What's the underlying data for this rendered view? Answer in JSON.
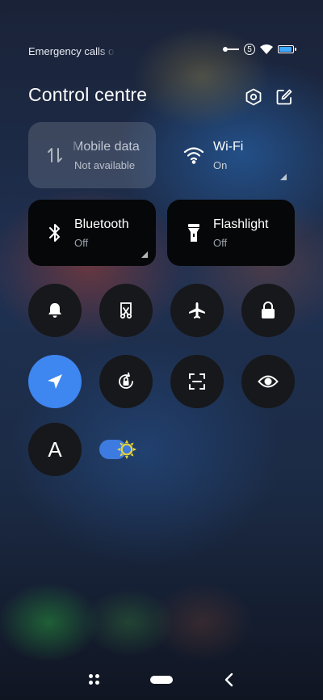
{
  "status_bar": {
    "text": "Emergency calls o",
    "sim_number": "5",
    "battery_level": 0.95
  },
  "header": {
    "title": "Control centre",
    "settings_icon": "hexagon-settings-icon",
    "edit_icon": "edit-icon"
  },
  "tiles": {
    "mobile_data": {
      "label": "Mobile data",
      "status": "Not available",
      "icon": "mobile-data-icon"
    },
    "wifi": {
      "label": "Wi-Fi",
      "status": "On",
      "icon": "wifi-icon"
    },
    "bluetooth": {
      "label": "Bluetooth",
      "status": "Off",
      "icon": "bluetooth-icon"
    },
    "flashlight": {
      "label": "Flashlight",
      "status": "Off",
      "icon": "flashlight-icon"
    }
  },
  "toggles_row1": [
    "bell-icon",
    "screenshot-icon",
    "airplane-icon",
    "lock-icon"
  ],
  "toggles_row2": [
    "location-icon",
    "rotation-lock-icon",
    "scan-icon",
    "eye-icon"
  ],
  "toggles_row3": {
    "font_button_glyph": "A",
    "auto_brightness_icon": "sun-icon",
    "auto_brightness_on": true
  },
  "colors": {
    "accent": "#3e86f0",
    "tile_dark": "#060708",
    "round_bg": "#17181b"
  }
}
